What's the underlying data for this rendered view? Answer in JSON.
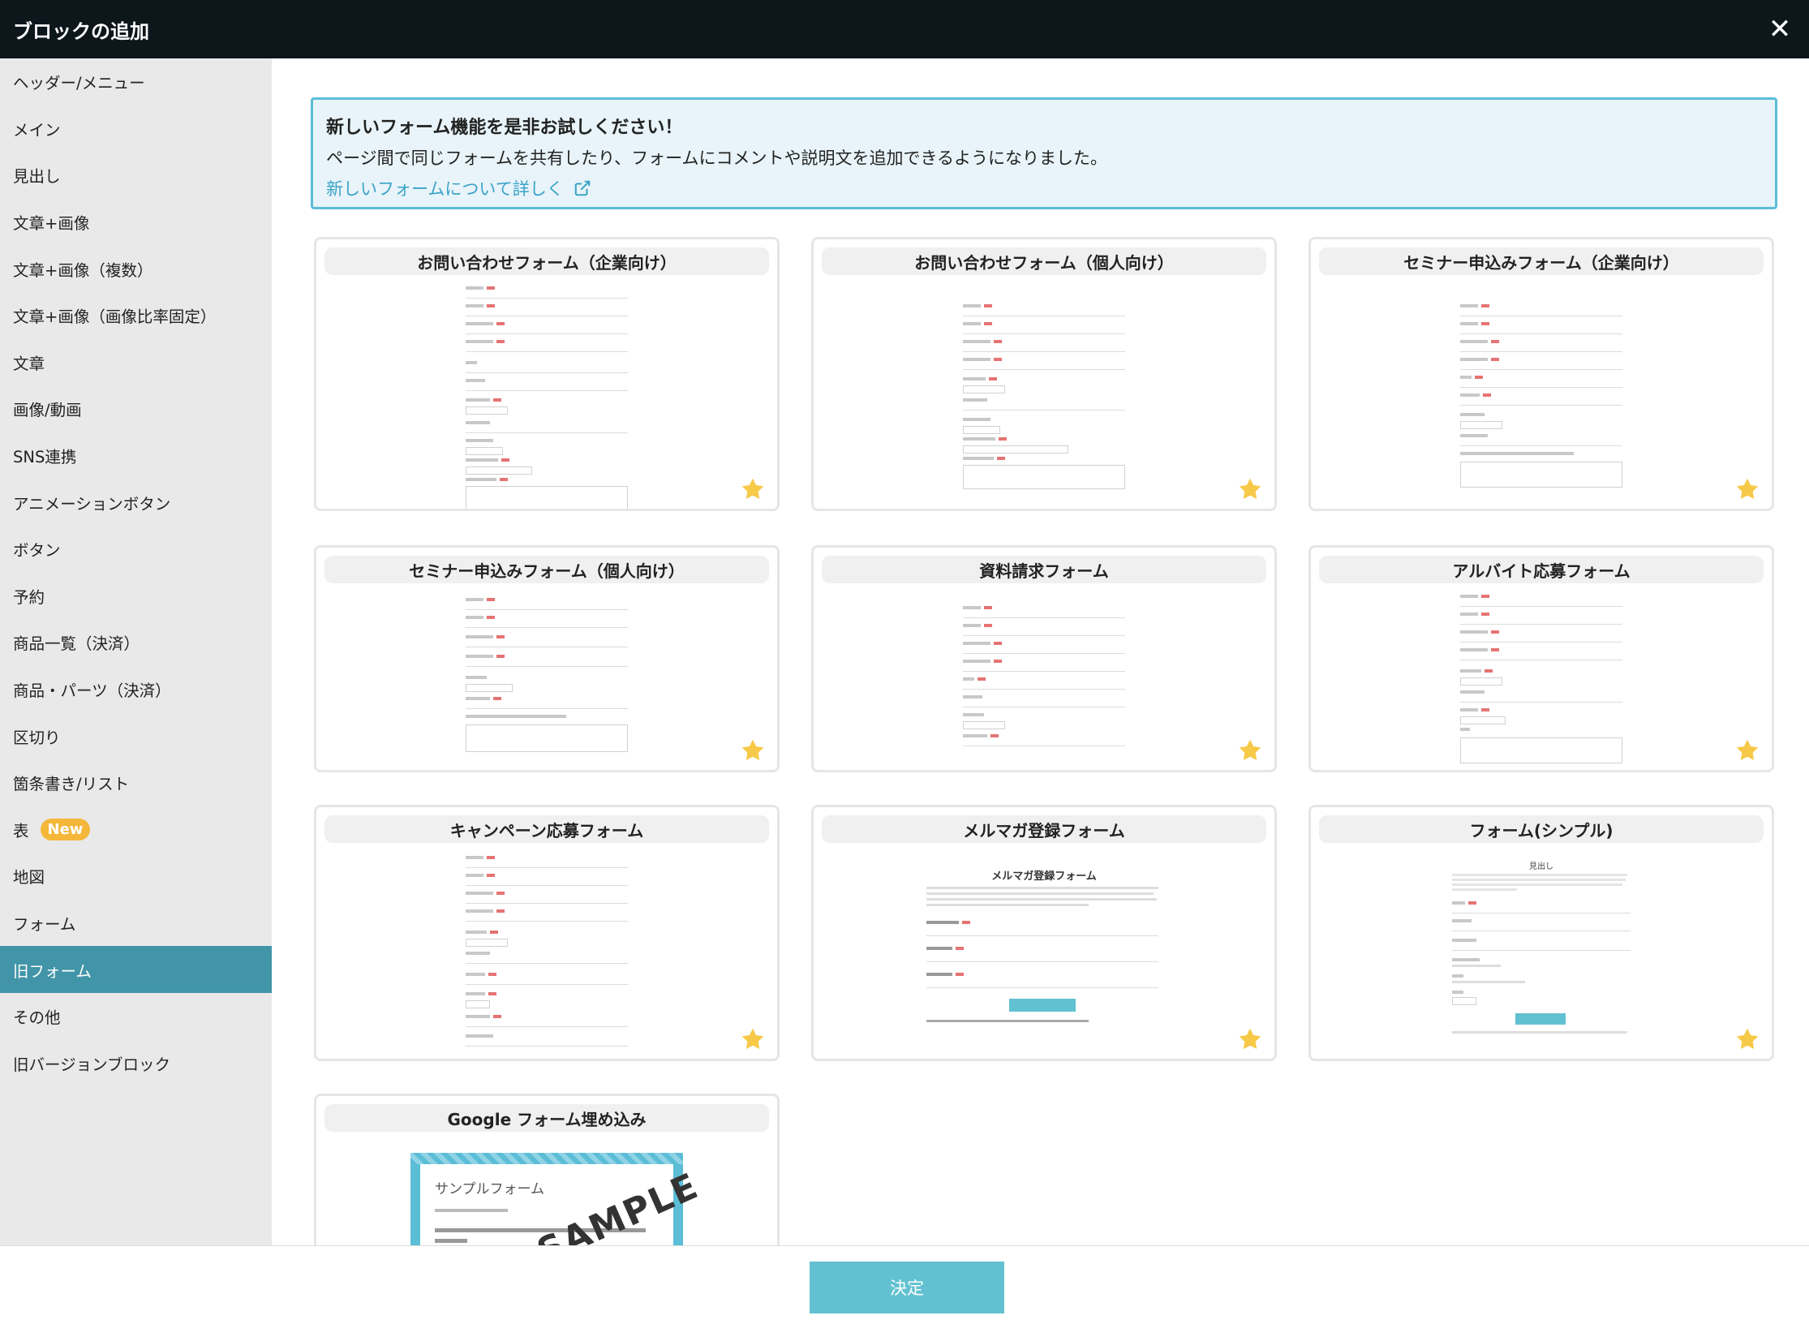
{
  "dialog": {
    "title": "ブロックの追加"
  },
  "sidebar": {
    "items": [
      {
        "label": "ヘッダー/メニュー"
      },
      {
        "label": "メイン"
      },
      {
        "label": "見出し"
      },
      {
        "label": "文章+画像"
      },
      {
        "label": "文章+画像（複数）"
      },
      {
        "label": "文章+画像（画像比率固定）"
      },
      {
        "label": "文章"
      },
      {
        "label": "画像/動画"
      },
      {
        "label": "SNS連携"
      },
      {
        "label": "アニメーションボタン"
      },
      {
        "label": "ボタン"
      },
      {
        "label": "予約"
      },
      {
        "label": "商品一覧（決済）"
      },
      {
        "label": "商品・パーツ（決済）"
      },
      {
        "label": "区切り"
      },
      {
        "label": "箇条書き/リスト"
      },
      {
        "label": "表",
        "badge": "New"
      },
      {
        "label": "地図"
      },
      {
        "label": "フォーム"
      },
      {
        "label": "旧フォーム",
        "active": true
      },
      {
        "label": "その他"
      },
      {
        "label": "旧バージョンブロック"
      }
    ]
  },
  "notice": {
    "title": "新しいフォーム機能を是非お試しください！",
    "body": "ページ間で同じフォームを共有したり、フォームにコメントや説明文を追加できるようになりました。",
    "link": "新しいフォームについて詳しく"
  },
  "cards": [
    {
      "title": "お問い合わせフォーム（企業向け）"
    },
    {
      "title": "お問い合わせフォーム（個人向け）"
    },
    {
      "title": "セミナー申込みフォーム（企業向け）"
    },
    {
      "title": "セミナー申込みフォーム（個人向け）"
    },
    {
      "title": "資料請求フォーム"
    },
    {
      "title": "アルバイト応募フォーム"
    },
    {
      "title": "キャンペーン応募フォーム"
    },
    {
      "title": "メルマガ登録フォーム",
      "preview_title": "メルマガ登録フォーム"
    },
    {
      "title": "フォーム(シンプル)",
      "preview_title": "見出し"
    },
    {
      "title": "Google フォーム埋め込み",
      "preview_title": "サンプルフォーム",
      "preview_watermark": "SAMPLE"
    }
  ],
  "footer": {
    "submit_label": "決定"
  },
  "colors": {
    "accent": "#4295a8",
    "button": "#62c1d1",
    "star": "#f7c948",
    "badge": "#f4b73a"
  }
}
